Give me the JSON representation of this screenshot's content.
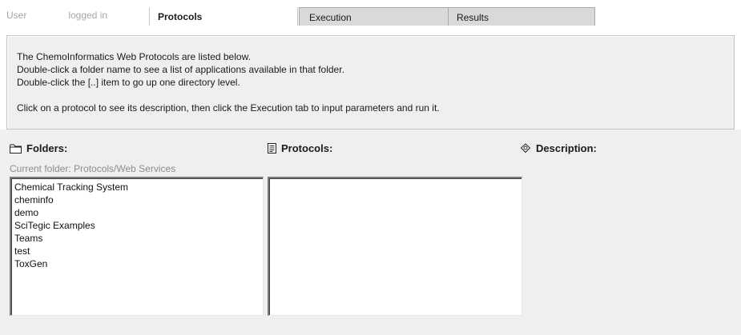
{
  "header": {
    "user_label": "User",
    "user_state": "logged in",
    "tabs": [
      {
        "label": "Protocols",
        "active": true
      },
      {
        "label": "Execution",
        "active": false
      },
      {
        "label": "Results",
        "active": false
      }
    ]
  },
  "instructions": {
    "line1": "The ChemoInformatics Web Protocols are listed below.",
    "line2": "Double-click a folder name to see a list of applications available in that folder.",
    "line3": "Double-click the [..] item to go up one directory level.",
    "line4": "Click on a protocol to see its description, then click the Execution tab to input parameters and run it."
  },
  "folders": {
    "heading": "Folders:",
    "current_folder": "Current folder: Protocols/Web Services",
    "items": [
      "Chemical Tracking System",
      "cheminfo",
      "demo",
      "SciTegic Examples",
      "Teams",
      "test",
      "ToxGen"
    ],
    "icon": "folder-icon"
  },
  "protocols": {
    "heading": "Protocols:",
    "items": [],
    "icon": "document-icon"
  },
  "description": {
    "heading": "Description:",
    "icon": "molecule-icon"
  },
  "colors": {
    "panel_bg": "#efefef",
    "inactive_tab_bg": "#d9d9d9",
    "muted_text": "#a6a6a6"
  }
}
